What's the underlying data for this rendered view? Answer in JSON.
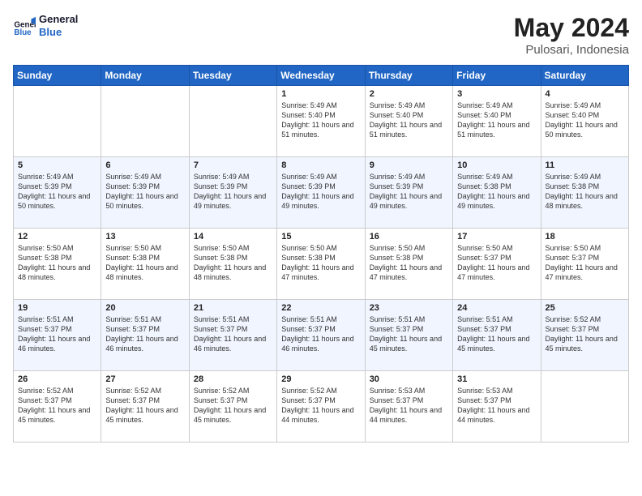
{
  "header": {
    "logo_line1": "General",
    "logo_line2": "Blue",
    "title": "May 2024",
    "subtitle": "Pulosari, Indonesia"
  },
  "days_of_week": [
    "Sunday",
    "Monday",
    "Tuesday",
    "Wednesday",
    "Thursday",
    "Friday",
    "Saturday"
  ],
  "weeks": [
    [
      {
        "day": "",
        "sunrise": "",
        "sunset": "",
        "daylight": ""
      },
      {
        "day": "",
        "sunrise": "",
        "sunset": "",
        "daylight": ""
      },
      {
        "day": "",
        "sunrise": "",
        "sunset": "",
        "daylight": ""
      },
      {
        "day": "1",
        "sunrise": "Sunrise: 5:49 AM",
        "sunset": "Sunset: 5:40 PM",
        "daylight": "Daylight: 11 hours and 51 minutes."
      },
      {
        "day": "2",
        "sunrise": "Sunrise: 5:49 AM",
        "sunset": "Sunset: 5:40 PM",
        "daylight": "Daylight: 11 hours and 51 minutes."
      },
      {
        "day": "3",
        "sunrise": "Sunrise: 5:49 AM",
        "sunset": "Sunset: 5:40 PM",
        "daylight": "Daylight: 11 hours and 51 minutes."
      },
      {
        "day": "4",
        "sunrise": "Sunrise: 5:49 AM",
        "sunset": "Sunset: 5:40 PM",
        "daylight": "Daylight: 11 hours and 50 minutes."
      }
    ],
    [
      {
        "day": "5",
        "sunrise": "Sunrise: 5:49 AM",
        "sunset": "Sunset: 5:39 PM",
        "daylight": "Daylight: 11 hours and 50 minutes."
      },
      {
        "day": "6",
        "sunrise": "Sunrise: 5:49 AM",
        "sunset": "Sunset: 5:39 PM",
        "daylight": "Daylight: 11 hours and 50 minutes."
      },
      {
        "day": "7",
        "sunrise": "Sunrise: 5:49 AM",
        "sunset": "Sunset: 5:39 PM",
        "daylight": "Daylight: 11 hours and 49 minutes."
      },
      {
        "day": "8",
        "sunrise": "Sunrise: 5:49 AM",
        "sunset": "Sunset: 5:39 PM",
        "daylight": "Daylight: 11 hours and 49 minutes."
      },
      {
        "day": "9",
        "sunrise": "Sunrise: 5:49 AM",
        "sunset": "Sunset: 5:39 PM",
        "daylight": "Daylight: 11 hours and 49 minutes."
      },
      {
        "day": "10",
        "sunrise": "Sunrise: 5:49 AM",
        "sunset": "Sunset: 5:38 PM",
        "daylight": "Daylight: 11 hours and 49 minutes."
      },
      {
        "day": "11",
        "sunrise": "Sunrise: 5:49 AM",
        "sunset": "Sunset: 5:38 PM",
        "daylight": "Daylight: 11 hours and 48 minutes."
      }
    ],
    [
      {
        "day": "12",
        "sunrise": "Sunrise: 5:50 AM",
        "sunset": "Sunset: 5:38 PM",
        "daylight": "Daylight: 11 hours and 48 minutes."
      },
      {
        "day": "13",
        "sunrise": "Sunrise: 5:50 AM",
        "sunset": "Sunset: 5:38 PM",
        "daylight": "Daylight: 11 hours and 48 minutes."
      },
      {
        "day": "14",
        "sunrise": "Sunrise: 5:50 AM",
        "sunset": "Sunset: 5:38 PM",
        "daylight": "Daylight: 11 hours and 48 minutes."
      },
      {
        "day": "15",
        "sunrise": "Sunrise: 5:50 AM",
        "sunset": "Sunset: 5:38 PM",
        "daylight": "Daylight: 11 hours and 47 minutes."
      },
      {
        "day": "16",
        "sunrise": "Sunrise: 5:50 AM",
        "sunset": "Sunset: 5:38 PM",
        "daylight": "Daylight: 11 hours and 47 minutes."
      },
      {
        "day": "17",
        "sunrise": "Sunrise: 5:50 AM",
        "sunset": "Sunset: 5:37 PM",
        "daylight": "Daylight: 11 hours and 47 minutes."
      },
      {
        "day": "18",
        "sunrise": "Sunrise: 5:50 AM",
        "sunset": "Sunset: 5:37 PM",
        "daylight": "Daylight: 11 hours and 47 minutes."
      }
    ],
    [
      {
        "day": "19",
        "sunrise": "Sunrise: 5:51 AM",
        "sunset": "Sunset: 5:37 PM",
        "daylight": "Daylight: 11 hours and 46 minutes."
      },
      {
        "day": "20",
        "sunrise": "Sunrise: 5:51 AM",
        "sunset": "Sunset: 5:37 PM",
        "daylight": "Daylight: 11 hours and 46 minutes."
      },
      {
        "day": "21",
        "sunrise": "Sunrise: 5:51 AM",
        "sunset": "Sunset: 5:37 PM",
        "daylight": "Daylight: 11 hours and 46 minutes."
      },
      {
        "day": "22",
        "sunrise": "Sunrise: 5:51 AM",
        "sunset": "Sunset: 5:37 PM",
        "daylight": "Daylight: 11 hours and 46 minutes."
      },
      {
        "day": "23",
        "sunrise": "Sunrise: 5:51 AM",
        "sunset": "Sunset: 5:37 PM",
        "daylight": "Daylight: 11 hours and 45 minutes."
      },
      {
        "day": "24",
        "sunrise": "Sunrise: 5:51 AM",
        "sunset": "Sunset: 5:37 PM",
        "daylight": "Daylight: 11 hours and 45 minutes."
      },
      {
        "day": "25",
        "sunrise": "Sunrise: 5:52 AM",
        "sunset": "Sunset: 5:37 PM",
        "daylight": "Daylight: 11 hours and 45 minutes."
      }
    ],
    [
      {
        "day": "26",
        "sunrise": "Sunrise: 5:52 AM",
        "sunset": "Sunset: 5:37 PM",
        "daylight": "Daylight: 11 hours and 45 minutes."
      },
      {
        "day": "27",
        "sunrise": "Sunrise: 5:52 AM",
        "sunset": "Sunset: 5:37 PM",
        "daylight": "Daylight: 11 hours and 45 minutes."
      },
      {
        "day": "28",
        "sunrise": "Sunrise: 5:52 AM",
        "sunset": "Sunset: 5:37 PM",
        "daylight": "Daylight: 11 hours and 45 minutes."
      },
      {
        "day": "29",
        "sunrise": "Sunrise: 5:52 AM",
        "sunset": "Sunset: 5:37 PM",
        "daylight": "Daylight: 11 hours and 44 minutes."
      },
      {
        "day": "30",
        "sunrise": "Sunrise: 5:53 AM",
        "sunset": "Sunset: 5:37 PM",
        "daylight": "Daylight: 11 hours and 44 minutes."
      },
      {
        "day": "31",
        "sunrise": "Sunrise: 5:53 AM",
        "sunset": "Sunset: 5:37 PM",
        "daylight": "Daylight: 11 hours and 44 minutes."
      },
      {
        "day": "",
        "sunrise": "",
        "sunset": "",
        "daylight": ""
      }
    ]
  ]
}
